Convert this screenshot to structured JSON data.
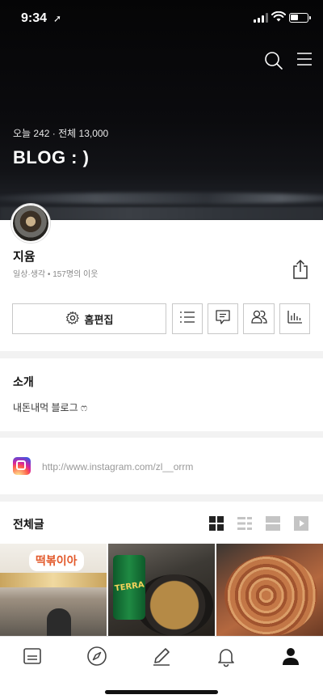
{
  "status_bar": {
    "time": "9:34",
    "location_glyph": "➚"
  },
  "hero": {
    "stats": "오늘 242 · 전체 13,000",
    "title": "BLOG : )",
    "icons": [
      "search-icon",
      "menu-icon"
    ]
  },
  "profile": {
    "name": "지윰",
    "subtitle": "일상·생각 • 157명의 이웃",
    "home_edit_label": "홈편집",
    "icons": [
      "share-icon",
      "gear-icon",
      "list-icon",
      "comment-icon",
      "neighbors-icon",
      "stats-icon"
    ]
  },
  "intro": {
    "heading": "소개",
    "text": "내돈내먹 블로그 ෆ"
  },
  "link": {
    "url": "http://www.instagram.com/zl__orrm",
    "icon": "instagram-icon"
  },
  "posts": {
    "heading": "전체글",
    "view_modes": [
      "grid-view-icon",
      "list-view-icon",
      "card-view-icon",
      "video-view-icon"
    ],
    "thumbnails": [
      {
        "caption": "떡볶이아",
        "label": ""
      },
      {
        "caption": "TERRA",
        "label": ""
      },
      {
        "caption": "",
        "label": ""
      }
    ]
  },
  "tab_bar": {
    "items": [
      "feed-icon",
      "compass-icon",
      "pencil-icon",
      "bell-icon",
      "profile-icon"
    ]
  },
  "colors": {
    "accent_active": "#111111",
    "muted": "#999999"
  }
}
